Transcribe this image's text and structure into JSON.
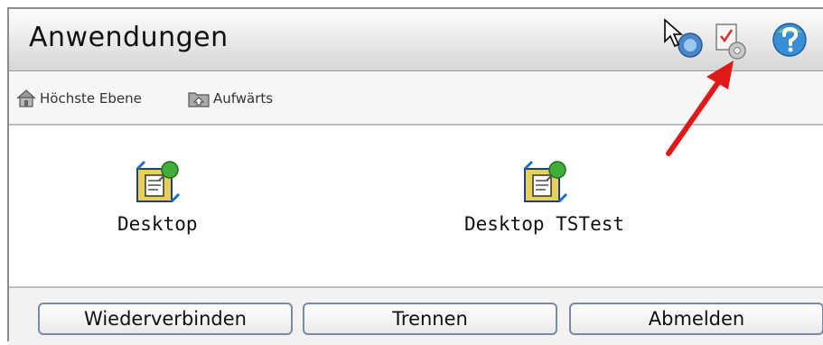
{
  "window": {
    "title": "Anwendungen"
  },
  "toolbar_icons": [
    "cursor-icon",
    "reconnect-icon",
    "settings-icon",
    "help-icon"
  ],
  "nav": {
    "top_level_label": "Höchste Ebene",
    "up_label": "Aufwärts"
  },
  "apps": [
    {
      "label": "Desktop",
      "icon": "app-icon"
    },
    {
      "label": "Desktop TSTest",
      "icon": "app-icon"
    }
  ],
  "buttons": {
    "reconnect_label": "Wiederverbinden",
    "disconnect_label": "Trennen",
    "logout_label": "Abmelden"
  },
  "colors": {
    "annotation_arrow": "#e01818",
    "button_border": "#7a8aa0"
  }
}
